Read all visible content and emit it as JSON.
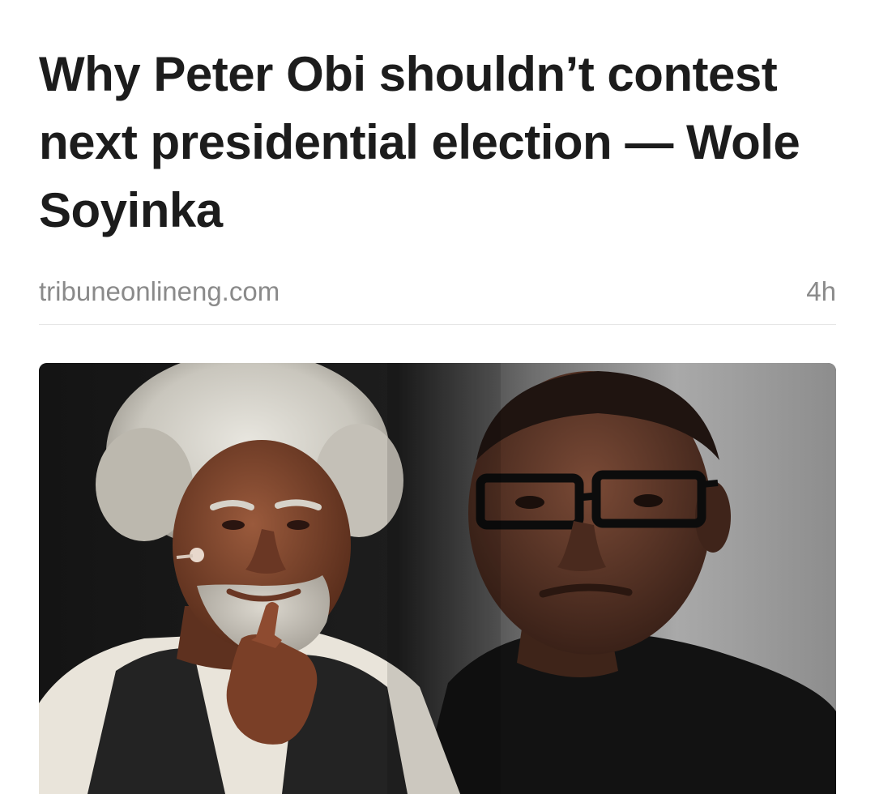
{
  "article": {
    "headline": "Why Peter Obi shouldn’t contest next presidential election — Wole Soyinka",
    "source": "tribuneonlineng.com",
    "time_ago": "4h",
    "image": {
      "subject_left": "white-haired-man-pointing",
      "subject_right": "man-with-glasses"
    }
  }
}
